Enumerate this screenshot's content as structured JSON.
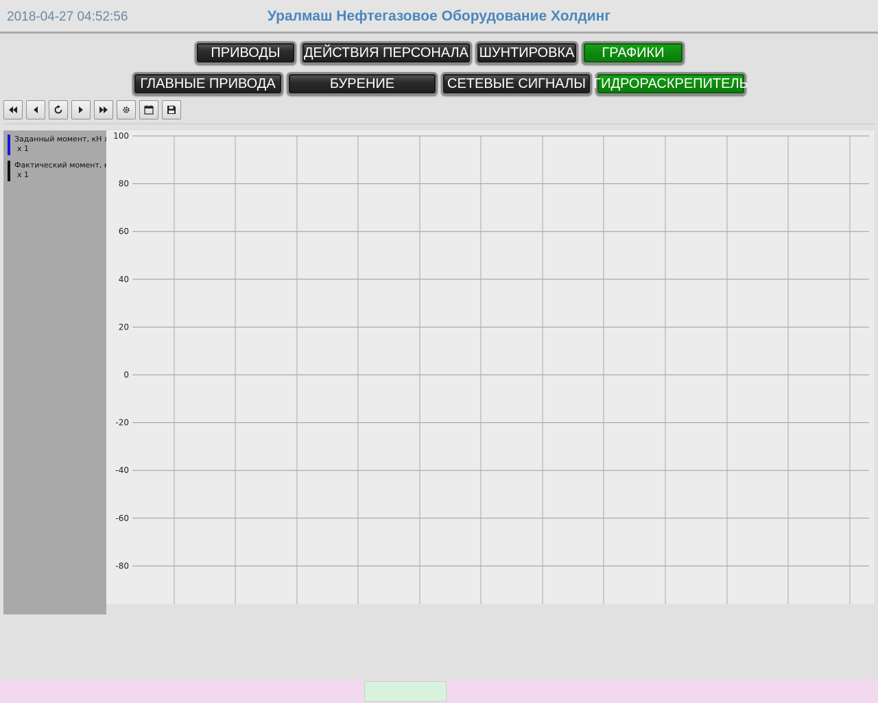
{
  "header": {
    "timestamp": "2018-04-27 04:52:56",
    "title": "Уралмаш Нефтегазовое Оборудование Холдинг"
  },
  "nav": {
    "row1": [
      {
        "label": "ПРИВОДЫ",
        "active": false
      },
      {
        "label": "ДЕЙСТВИЯ ПЕРСОНАЛА",
        "active": false
      },
      {
        "label": "ШУНТИРОВКА",
        "active": false
      },
      {
        "label": "ГРАФИКИ",
        "active": true
      }
    ],
    "row2": [
      {
        "label": "ГЛАВНЫЕ ПРИВОДА",
        "active": false
      },
      {
        "label": "БУРЕНИЕ",
        "active": false
      },
      {
        "label": "СЕТЕВЫЕ СИГНАЛЫ",
        "active": false
      },
      {
        "label": "ГИДРОРАСКРЕПИТЕЛЬ",
        "active": true
      }
    ]
  },
  "toolbar": {
    "icons": [
      "first-page-icon",
      "previous-icon",
      "refresh-icon",
      "next-icon",
      "last-page-icon",
      "settings-icon",
      "calendar-icon",
      "save-icon"
    ]
  },
  "legend": [
    {
      "label": "Заданный момент, кН x",
      "scale": "x 1",
      "color": "#1414e6"
    },
    {
      "label": "Фактический момент, кН",
      "scale": "x 1",
      "color": "#111111"
    }
  ],
  "chart_data": {
    "type": "line",
    "title": "",
    "xlabel": "",
    "ylabel": "",
    "ylim": [
      -100,
      100
    ],
    "y_ticks": [
      100,
      80,
      60,
      40,
      20,
      0,
      -20,
      -40,
      -60,
      -80
    ],
    "grid": true,
    "series": [
      {
        "name": "Заданный момент, кН x",
        "values": []
      },
      {
        "name": "Фактический момент, кН",
        "values": []
      }
    ]
  },
  "colors": {
    "active_button": "#0e8a0e",
    "button": "#1d1d1d",
    "title": "#4b87bd",
    "timestamp": "#6e8aa3"
  }
}
